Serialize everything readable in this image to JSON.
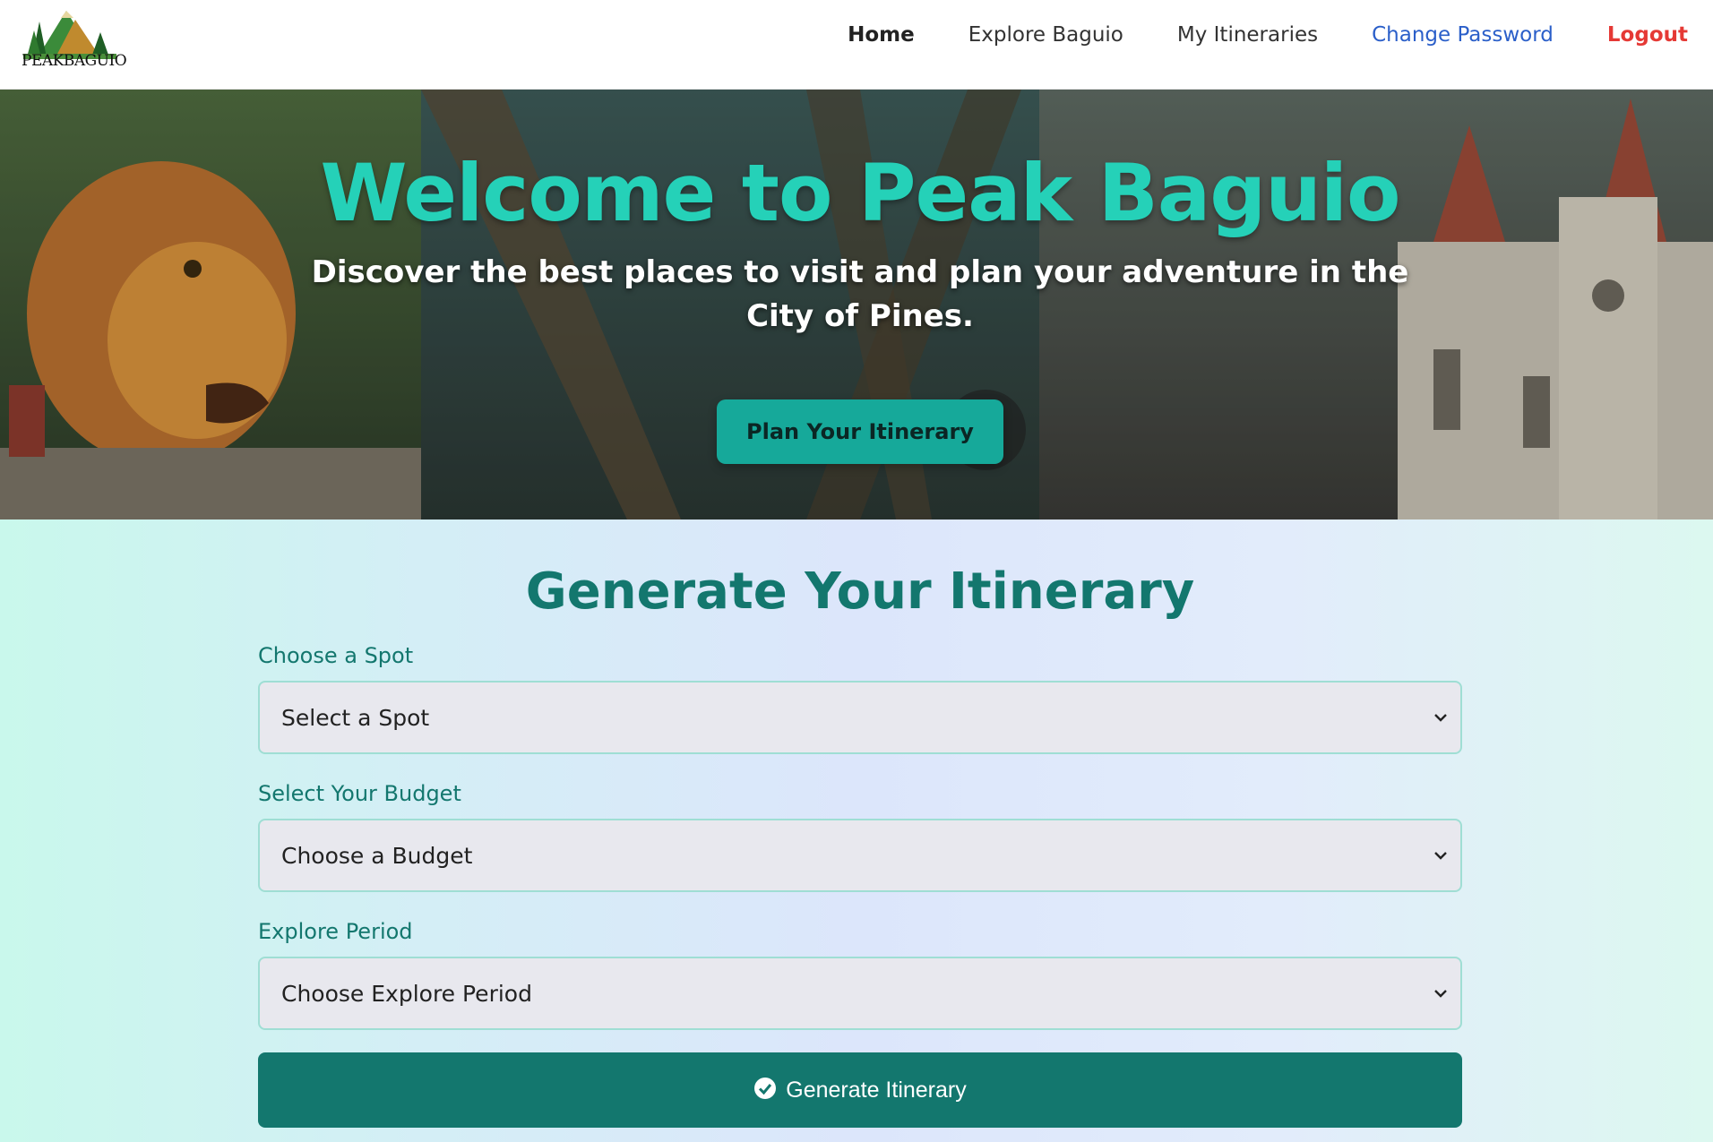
{
  "brand": {
    "logo_text": "PEAKBAGUIO"
  },
  "nav": {
    "home": "Home",
    "explore": "Explore Baguio",
    "itineraries": "My Itineraries",
    "change_password": "Change Password",
    "logout": "Logout"
  },
  "hero": {
    "title": "Welcome to Peak Baguio",
    "subtitle": "Discover the best places to visit and plan your adventure in the City of Pines.",
    "cta": "Plan Your Itinerary"
  },
  "form": {
    "title": "Generate Your Itinerary",
    "spot": {
      "label": "Choose a Spot",
      "value": "Select a Spot"
    },
    "budget": {
      "label": "Select Your Budget",
      "value": "Choose a Budget"
    },
    "period": {
      "label": "Explore Period",
      "value": "Choose Explore Period"
    },
    "submit": "Generate Itinerary"
  },
  "icons": {
    "logo": "mountain-pine-logo",
    "chevron": "chevron-down-icon",
    "check": "check-circle-icon"
  },
  "colors": {
    "accent": "#13776e",
    "hero_title": "#25d1b8",
    "cta_bg": "#16a99a",
    "link_blue": "#2b5fc9",
    "logout_red": "#e53935"
  }
}
